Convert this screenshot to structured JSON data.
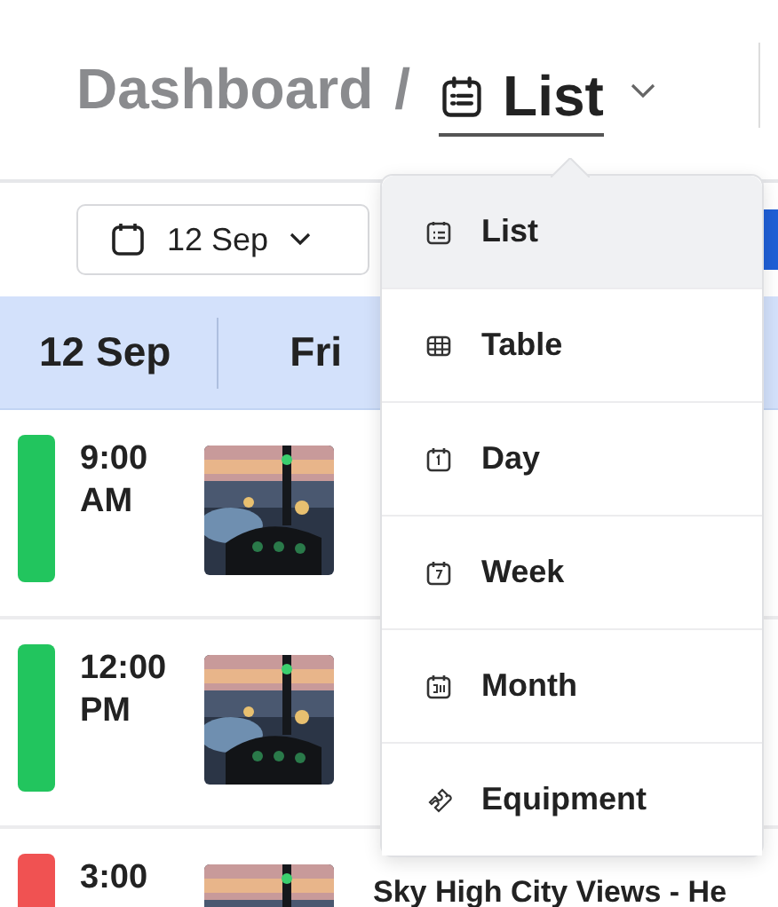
{
  "breadcrumb": {
    "parent": "Dashboard",
    "separator": "/"
  },
  "view_switch": {
    "label": "List",
    "selected": true
  },
  "date_picker": {
    "value": "12 Sep"
  },
  "day_header": {
    "date": "12 Sep",
    "weekday": "Fri"
  },
  "events": [
    {
      "start": "9:00",
      "period": "AM",
      "color": "#22c55e"
    },
    {
      "start": "12:00",
      "period": "PM",
      "color": "#22c55e"
    },
    {
      "start": "3:00",
      "color": "#f05252",
      "title": "Sky High City Views - He"
    }
  ],
  "view_menu": [
    {
      "label": "List",
      "kind": "list",
      "selected": true
    },
    {
      "label": "Table",
      "kind": "table",
      "selected": false
    },
    {
      "label": "Day",
      "kind": "day",
      "selected": false
    },
    {
      "label": "Week",
      "kind": "week",
      "selected": false
    },
    {
      "label": "Month",
      "kind": "month",
      "selected": false
    },
    {
      "label": "Equipment",
      "kind": "equipment",
      "selected": false
    }
  ]
}
